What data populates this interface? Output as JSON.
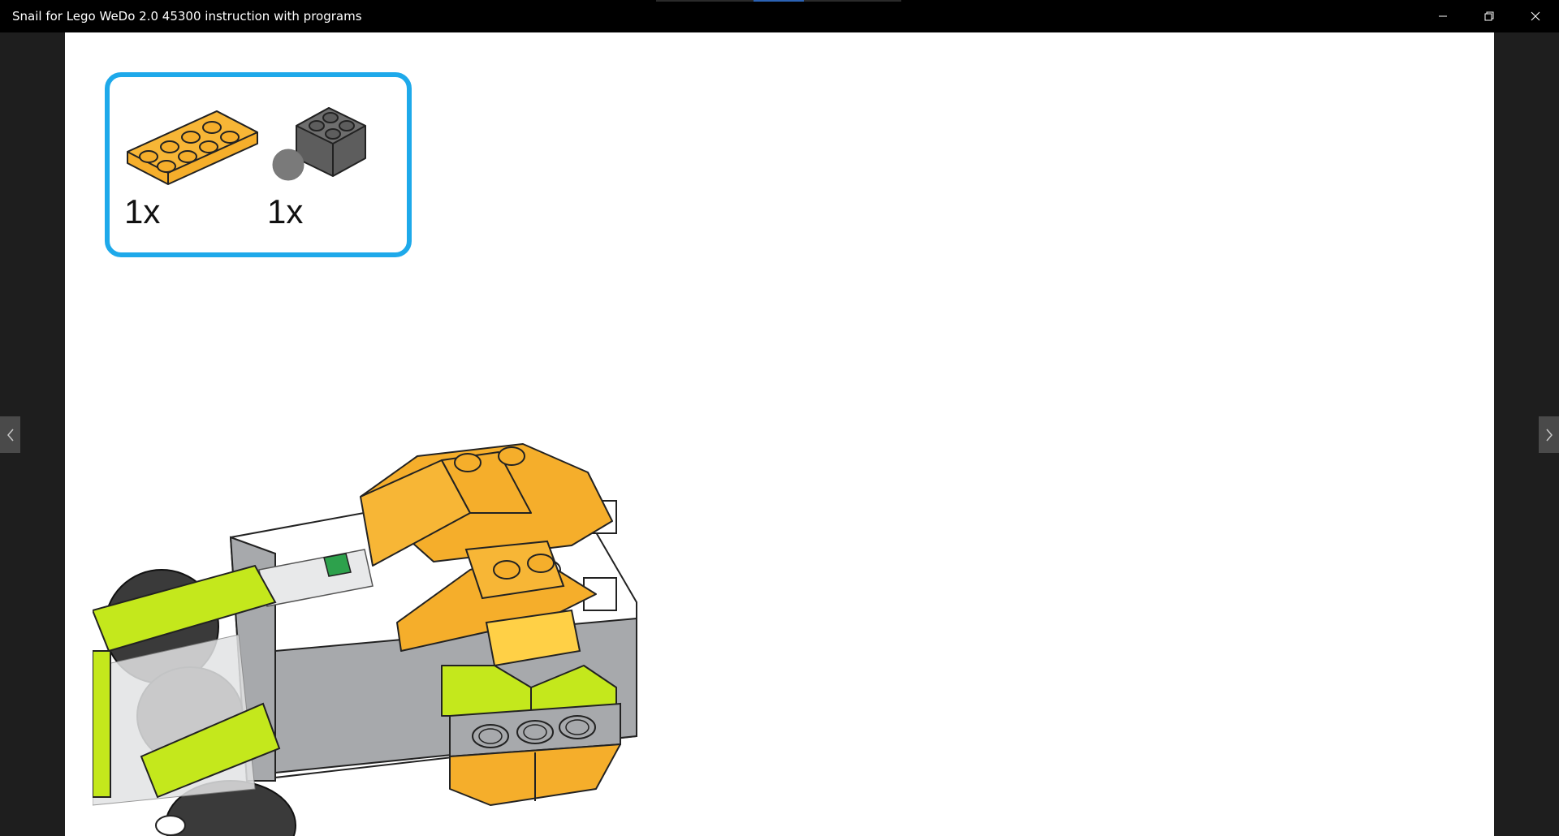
{
  "window": {
    "title": "Snail for Lego WeDo 2.0 45300 instruction with programs",
    "controls": [
      "minimize-icon",
      "restore-icon",
      "close-icon"
    ]
  },
  "navigation": {
    "prev_icon": "chevron-left-icon",
    "next_icon": "chevron-right-icon"
  },
  "parts_list": {
    "items": [
      {
        "name": "Yellow orange 2x4 plate",
        "quantity": "1x",
        "color": "#f5ae2b"
      },
      {
        "name": "Dark gray tilt sensor",
        "quantity": "1x",
        "color": "#5d5d5d"
      }
    ]
  },
  "colors": {
    "accent": "#1ea9ea",
    "titlebar": "#000000",
    "background": "#1e1e1e",
    "brick_orange": "#f5ae2b",
    "brick_lime": "#c4e81c",
    "brick_gray": "#a7a9ac",
    "brick_dark": "#5d5d5d",
    "brick_green": "#2da14c"
  }
}
